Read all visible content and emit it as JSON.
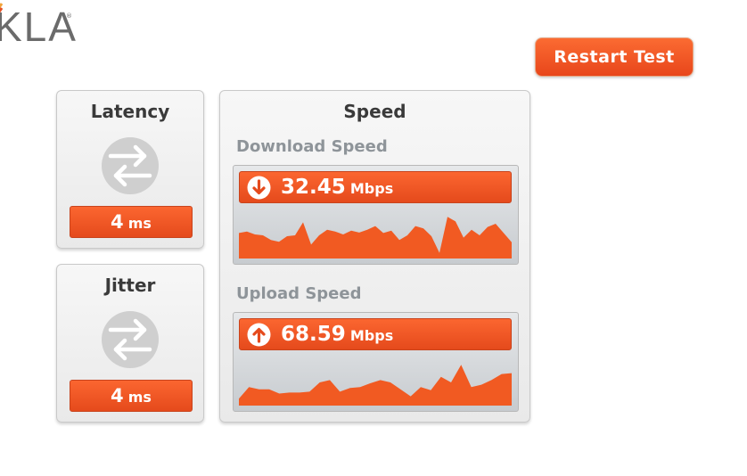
{
  "logo": {
    "text": "KLA",
    "registered": "®"
  },
  "restart": {
    "label": "Restart Test"
  },
  "latency": {
    "title": "Latency",
    "value": "4",
    "unit": "ms"
  },
  "jitter": {
    "title": "Jitter",
    "value": "4",
    "unit": "ms"
  },
  "speed": {
    "title": "Speed",
    "download": {
      "label": "Download Speed",
      "value": "32.45",
      "unit": "Mbps",
      "icon": "arrow-down-icon",
      "samples": [
        0.55,
        0.58,
        0.52,
        0.5,
        0.4,
        0.36,
        0.48,
        0.5,
        0.78,
        0.3,
        0.5,
        0.62,
        0.58,
        0.52,
        0.6,
        0.56,
        0.62,
        0.7,
        0.55,
        0.6,
        0.4,
        0.5,
        0.7,
        0.65,
        0.48,
        0.12,
        0.9,
        0.8,
        0.45,
        0.62,
        0.5,
        0.68,
        0.75,
        0.55,
        0.35
      ]
    },
    "upload": {
      "label": "Upload Speed",
      "value": "68.59",
      "unit": "Mbps",
      "icon": "arrow-up-icon",
      "samples": [
        0.15,
        0.4,
        0.35,
        0.35,
        0.26,
        0.28,
        0.28,
        0.3,
        0.5,
        0.55,
        0.3,
        0.38,
        0.4,
        0.48,
        0.55,
        0.5,
        0.35,
        0.2,
        0.4,
        0.33,
        0.62,
        0.5,
        0.88,
        0.4,
        0.45,
        0.55,
        0.68,
        0.7
      ]
    }
  },
  "colors": {
    "accent": "#f15a22",
    "graph": "#f15a22",
    "icon": "#cfcfcf"
  }
}
